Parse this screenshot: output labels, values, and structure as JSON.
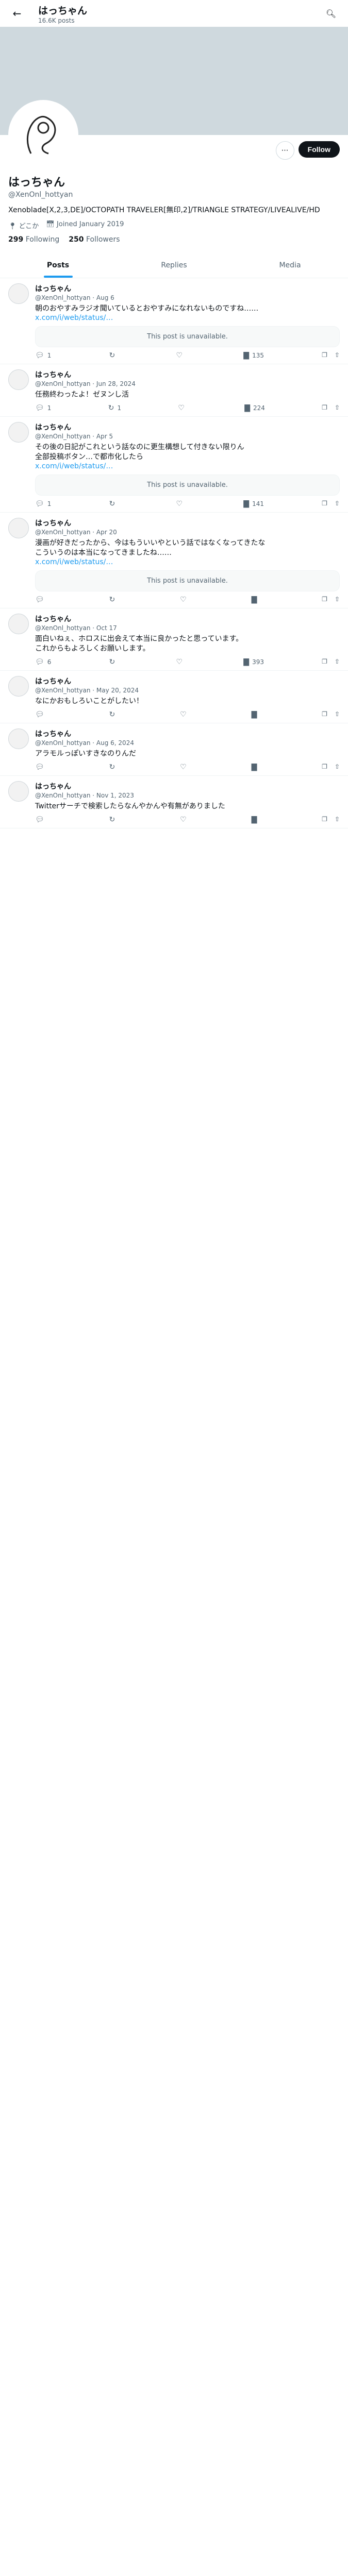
{
  "header": {
    "name": "はっちゃん",
    "post_count": "16.6K posts"
  },
  "profile": {
    "name": "はっちゃん",
    "handle": "@XenOnl_hottyan",
    "follow_label": "Follow",
    "bio": "Xenoblade[X,2,3,DE]/OCTOPATH TRAVELER[無印,2]/TRIANGLE STRATEGY/LIVEALIVE/HD",
    "location": "どこか",
    "joined": "Joined January 2019",
    "following_count": "299",
    "following_label": "Following",
    "followers_count": "250",
    "followers_label": "Followers"
  },
  "tabs": [
    "Posts",
    "Replies",
    "Media"
  ],
  "tweets": [
    {
      "name": "はっちゃん",
      "sub": "@XenOnl_hottyan · Aug 6",
      "text": "朝のおやすみラジオ聞いているとおやすみになれないものですね……",
      "link": "x.com/i/web/status/…",
      "unavail": "This post is unavailable.",
      "reply": "1",
      "rt": "",
      "like": "",
      "views": "135"
    },
    {
      "name": "はっちゃん",
      "sub": "@XenOnl_hottyan · Jun 28, 2024",
      "text": "任務終わったよ！ゼヌンし活",
      "link": "",
      "unavail": "",
      "reply": "1",
      "rt": "1",
      "like": "",
      "views": "224"
    },
    {
      "name": "はっちゃん",
      "sub": "@XenOnl_hottyan · Apr 5",
      "text": "その後の日記がこれという話なのに更生構想して付きない限りん\n全部投稿ボタン…で都市化したら",
      "link": "x.com/i/web/status/…",
      "unavail": "This post is unavailable.",
      "reply": "1",
      "rt": "",
      "like": "",
      "views": "141"
    },
    {
      "name": "はっちゃん",
      "sub": "@XenOnl_hottyan · Apr 20",
      "text": "漫画が好きだったから、今はもういいやという話ではなくなってきたな\nこういうのは本当になってきましたね……",
      "link": "x.com/i/web/status/…",
      "unavail": "This post is unavailable.",
      "reply": "",
      "rt": "",
      "like": "",
      "views": ""
    },
    {
      "name": "はっちゃん",
      "sub": "@XenOnl_hottyan · Oct 17",
      "text": "面白いねぇ、ホロスに出会えて本当に良かったと思っています。\nこれからもよろしくお願いします。",
      "link": "",
      "unavail": "",
      "reply": "6",
      "rt": "",
      "like": "",
      "views": "393"
    },
    {
      "name": "はっちゃん",
      "sub": "@XenOnl_hottyan · May 20, 2024",
      "text": "なにかおもしろいことがしたい！",
      "link": "",
      "unavail": "",
      "reply": "",
      "rt": "",
      "like": "",
      "views": ""
    },
    {
      "name": "はっちゃん",
      "sub": "@XenOnl_hottyan · Aug 6, 2024",
      "text": "アラモルっぽいすきなのりんだ",
      "link": "",
      "unavail": "",
      "reply": "",
      "rt": "",
      "like": "",
      "views": ""
    },
    {
      "name": "はっちゃん",
      "sub": "@XenOnl_hottyan · Nov 1, 2023",
      "text": "Twitterサーチで検索したらなんやかんや有無がありました",
      "link": "",
      "unavail": "",
      "reply": "",
      "rt": "",
      "like": "",
      "views": ""
    }
  ]
}
